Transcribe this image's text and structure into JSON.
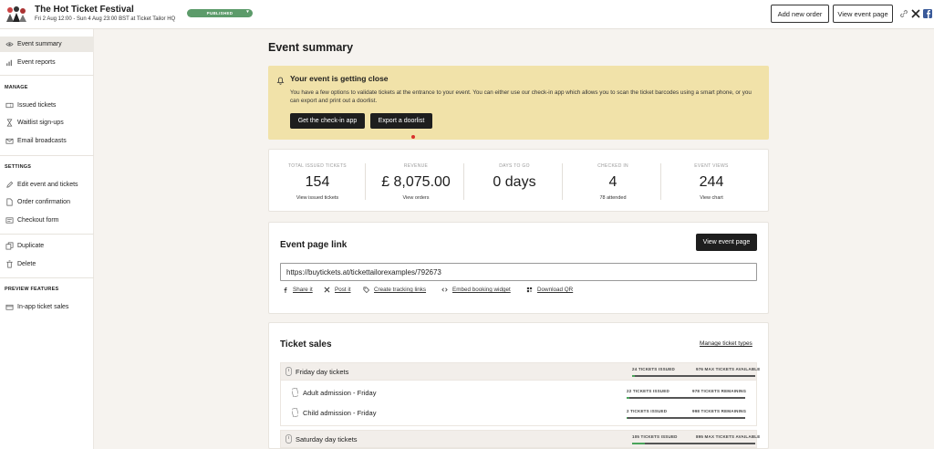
{
  "header": {
    "event_title": "The Hot Ticket Festival",
    "event_subtitle": "Fri 2 Aug 12:00 - Sun 4 Aug 23:00 BST at Ticket Tailor HQ",
    "status_badge": "PUBLISHED",
    "add_order_label": "Add new order",
    "view_event_label": "View event page",
    "accent_color": "#5c9b6a"
  },
  "sidebar": {
    "items_top": [
      {
        "label": "Event summary",
        "icon": "eye-icon"
      },
      {
        "label": "Event reports",
        "icon": "bar-chart-icon"
      }
    ],
    "manage_heading": "MANAGE",
    "manage_items": [
      {
        "label": "Issued tickets",
        "icon": "ticket-icon"
      },
      {
        "label": "Waitlist sign-ups",
        "icon": "hourglass-icon"
      },
      {
        "label": "Email broadcasts",
        "icon": "envelope-icon"
      }
    ],
    "settings_heading": "SETTINGS",
    "settings_items": [
      {
        "label": "Edit event and tickets",
        "icon": "pencil-icon"
      },
      {
        "label": "Order confirmation",
        "icon": "document-icon"
      },
      {
        "label": "Checkout form",
        "icon": "form-icon"
      }
    ],
    "action_items": [
      {
        "label": "Duplicate",
        "icon": "copy-icon"
      },
      {
        "label": "Delete",
        "icon": "trash-icon"
      }
    ],
    "preview_heading": "PREVIEW FEATURES",
    "preview_items": [
      {
        "label": "In-app ticket sales",
        "icon": "card-icon"
      }
    ]
  },
  "main": {
    "page_title": "Event summary",
    "alert": {
      "title": "Your event is getting close",
      "body": "You have a few options to validate tickets at the entrance to your event. You can either use our check-in app which allows you to scan the ticket barcodes using a smart phone, or you can export and print out a doorlist.",
      "checkin_button": "Get the check-in app",
      "doorlist_button": "Export a doorlist",
      "background_color": "#f1e2a9"
    },
    "stats": [
      {
        "label": "TOTAL ISSUED TICKETS",
        "value": "154",
        "link": "View issued tickets"
      },
      {
        "label": "REVENUE",
        "value": "£ 8,075.00",
        "link": "View orders"
      },
      {
        "label": "DAYS TO GO",
        "value": "0 days",
        "link": ""
      },
      {
        "label": "CHECKED IN",
        "value": "4",
        "link": "78 attended"
      },
      {
        "label": "EVENT VIEWS",
        "value": "244",
        "link": "View chart"
      }
    ],
    "event_link": {
      "title": "Event page link",
      "button": "View event page",
      "url": "https://buytickets.at/tickettailorexamples/792673",
      "share": "Share it",
      "post": "Post it",
      "tracking": "Create tracking links",
      "embed": "Embed booking widget",
      "qr": "Download QR"
    },
    "ticket_sales": {
      "title": "Ticket sales",
      "manage_link": "Manage ticket types",
      "groups": [
        {
          "name": "Friday day tickets",
          "issued": "24 TICKETS ISSUED",
          "available": "976 MAX TICKETS AVAILABLE",
          "progress": 0.024,
          "tickets": [
            {
              "name": "Adult admission - Friday",
              "issued": "22 TICKETS ISSUED",
              "remaining": "978 TICKETS REMAINING",
              "progress": 0.022
            },
            {
              "name": "Child admission - Friday",
              "issued": "2 TICKETS ISSUED",
              "remaining": "998 TICKETS REMAINING",
              "progress": 0.002
            }
          ]
        },
        {
          "name": "Saturday day tickets",
          "issued": "105 TICKETS ISSUED",
          "available": "895 MAX TICKETS AVAILABLE",
          "progress": 0.105
        }
      ]
    }
  }
}
